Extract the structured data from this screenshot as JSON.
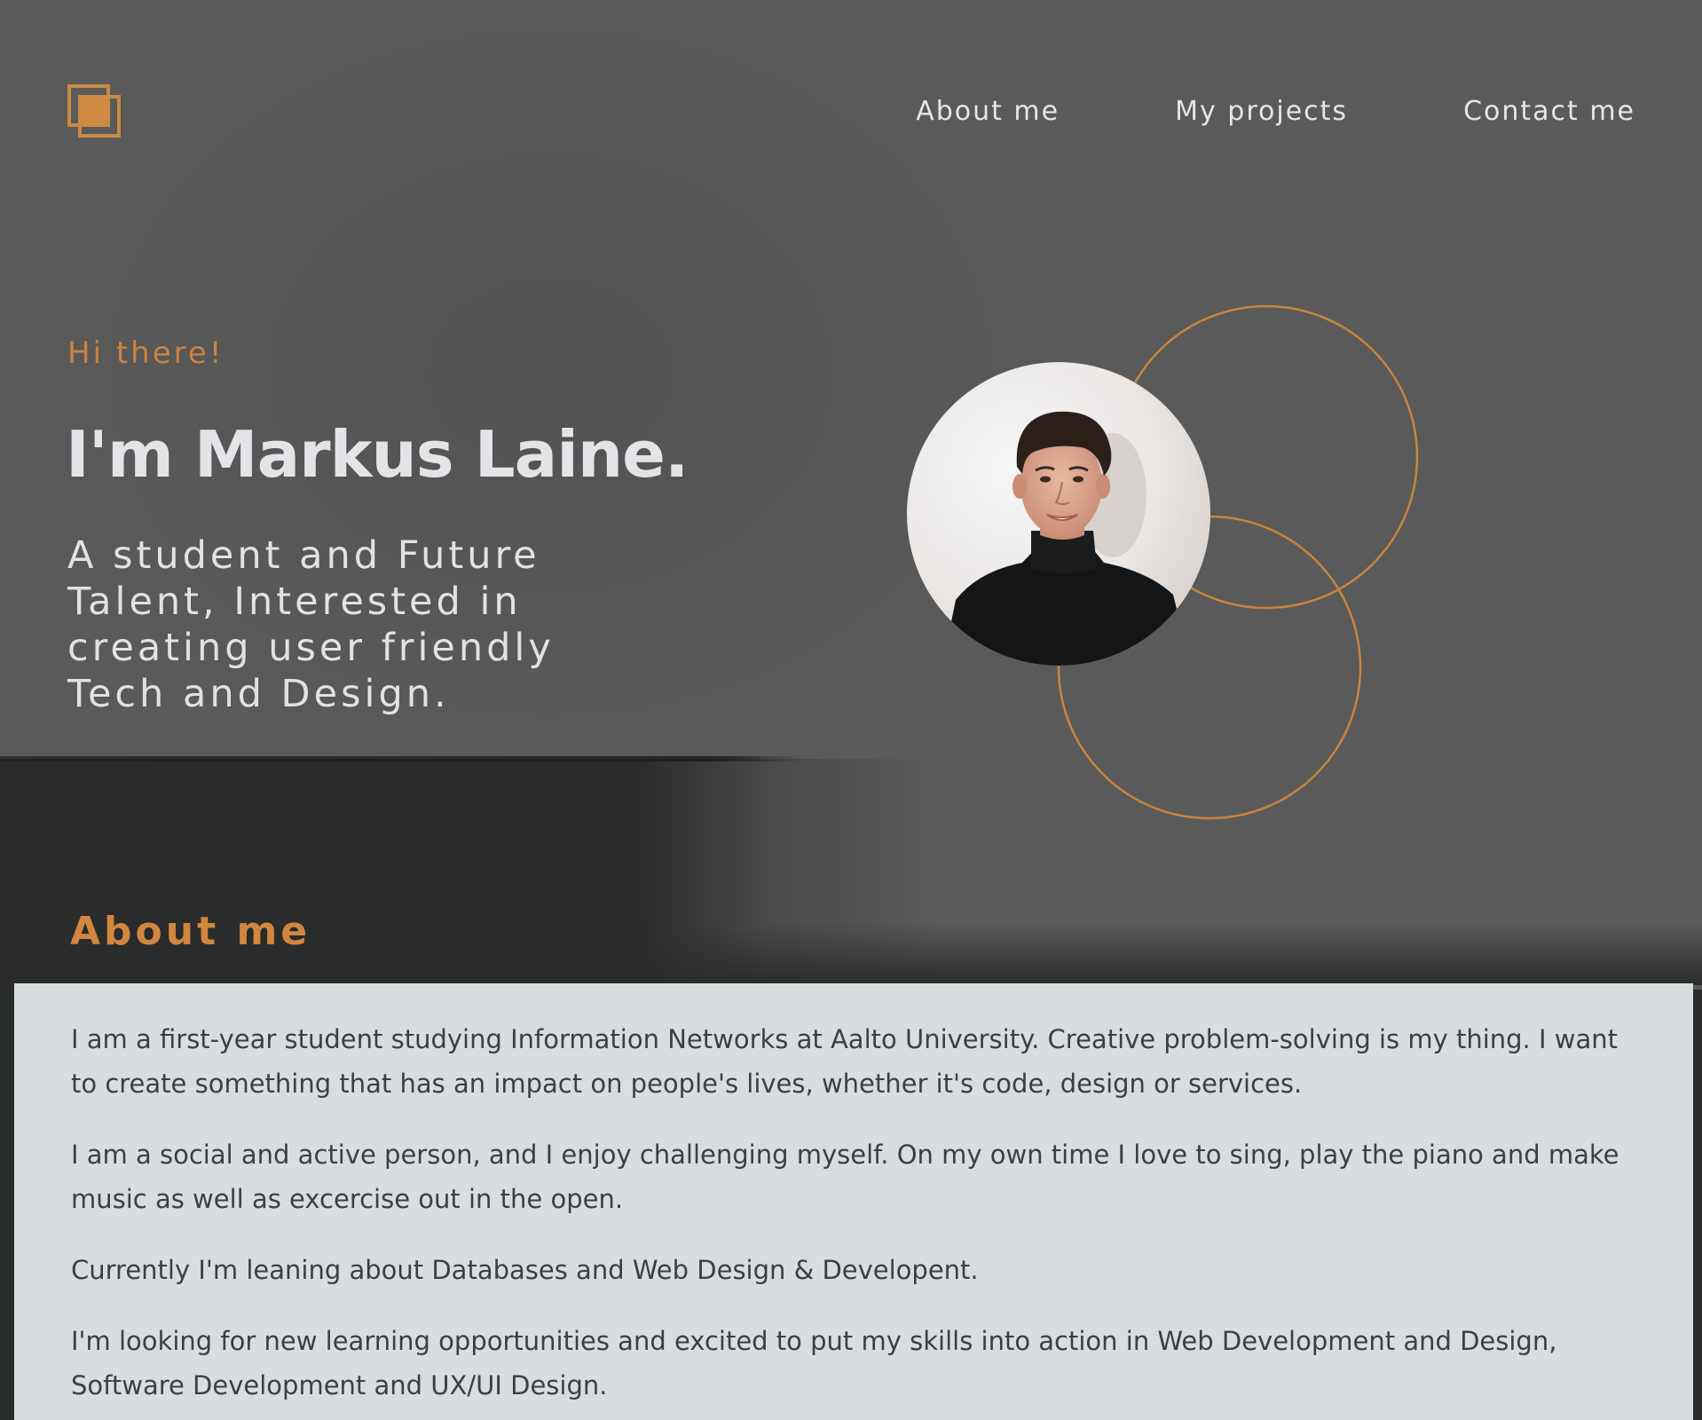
{
  "colors": {
    "accent": "#d1873f",
    "background": "#595a59",
    "dark_band": "#2a2b2b",
    "card": "#dadddf",
    "text_light": "#e2e4e7",
    "text_dark": "#3d3f41"
  },
  "header": {
    "logo_icon": "stacked-squares-icon",
    "nav": {
      "about": "About me",
      "projects": "My projects",
      "contact": "Contact me"
    }
  },
  "hero": {
    "greeting": "Hi there!",
    "name": "I'm Markus Laine.",
    "tagline": "A student and Future Talent, Interested in creating user friendly Tech and Design.",
    "portrait_icon": "profile-photo"
  },
  "about": {
    "heading": "About me",
    "paragraphs": [
      "I am a first-year student studying Information Networks at Aalto University. Creative problem-solving is my thing. I want to create something that has an impact on people's lives, whether it's code, design or services.",
      "I am a social and active person, and I enjoy challenging myself. On my own time I love to sing, play the piano and make music as well as excercise out in the open.",
      "Currently I'm leaning about Databases and Web Design & Developent.",
      "I'm looking for new learning opportunities and excited to put my skills into action in Web Development and Design, Software Development and UX/UI Design."
    ]
  }
}
